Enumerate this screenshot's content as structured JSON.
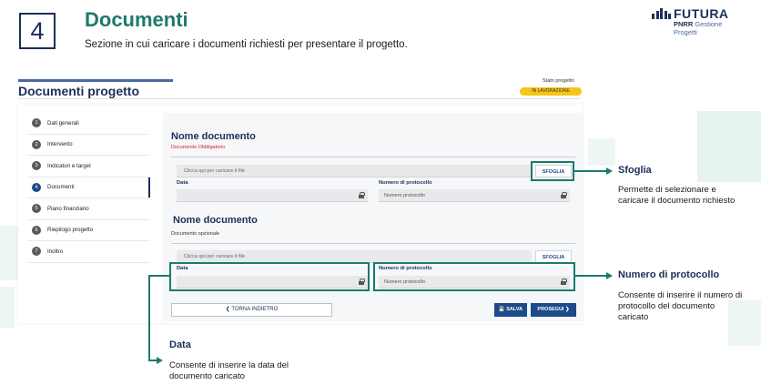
{
  "header": {
    "step_number": "4",
    "title": "Documenti",
    "subtitle": "Sezione in cui caricare i documenti richiesti per presentare il progetto."
  },
  "logo": {
    "word": "FUTURA",
    "sub_brand": "PNRR",
    "sub_text": "Gestione Progetti"
  },
  "app": {
    "section_title": "Documenti progetto",
    "state_label": "Stato progetto",
    "state_value": "IN LAVORAZIONE",
    "sidebar": [
      {
        "num": "1",
        "label": "Dati generali"
      },
      {
        "num": "2",
        "label": "Intervento"
      },
      {
        "num": "3",
        "label": "Indicatori e target"
      },
      {
        "num": "4",
        "label": "Documenti",
        "active": true
      },
      {
        "num": "5",
        "label": "Piano finanziario"
      },
      {
        "num": "6",
        "label": "Riepilogo progetto"
      },
      {
        "num": "7",
        "label": "Inoltro"
      }
    ],
    "doc1": {
      "title": "Nome documento",
      "requirement": "Documento Obbligatorio",
      "upload_placeholder": "Clicca qui per caricare il file",
      "browse_label": "SFOGLIA",
      "date_label": "Data",
      "protocol_label": "Numero di protocollo",
      "protocol_placeholder": "Numero protocollo"
    },
    "doc2": {
      "title": "Nome documento",
      "requirement": "Documento opzionale",
      "upload_placeholder": "Clicca qui per caricare il file",
      "browse_label": "SFOGLIA",
      "date_label": "Data",
      "protocol_label": "Numero di protocollo",
      "protocol_placeholder": "Numero protocollo"
    },
    "back_label": "❮ TORNA INDIETRO",
    "save_label": "💾 SALVA",
    "next_label": "PROSEGUI ❯"
  },
  "annotations": {
    "sfoglia": {
      "title": "Sfoglia",
      "text": "Permette di selezionare e caricare il documento richiesto"
    },
    "protocollo": {
      "title": "Numero di protocollo",
      "text": "Consente di inserire il numero di protocollo del documento caricato"
    },
    "data": {
      "title": "Data",
      "text": "Consente di inserire la data del documento caricato"
    }
  },
  "colors": {
    "accent": "#1d7a6c",
    "navy": "#1c2e5a",
    "badge": "#f5c518",
    "required": "#d42020"
  }
}
